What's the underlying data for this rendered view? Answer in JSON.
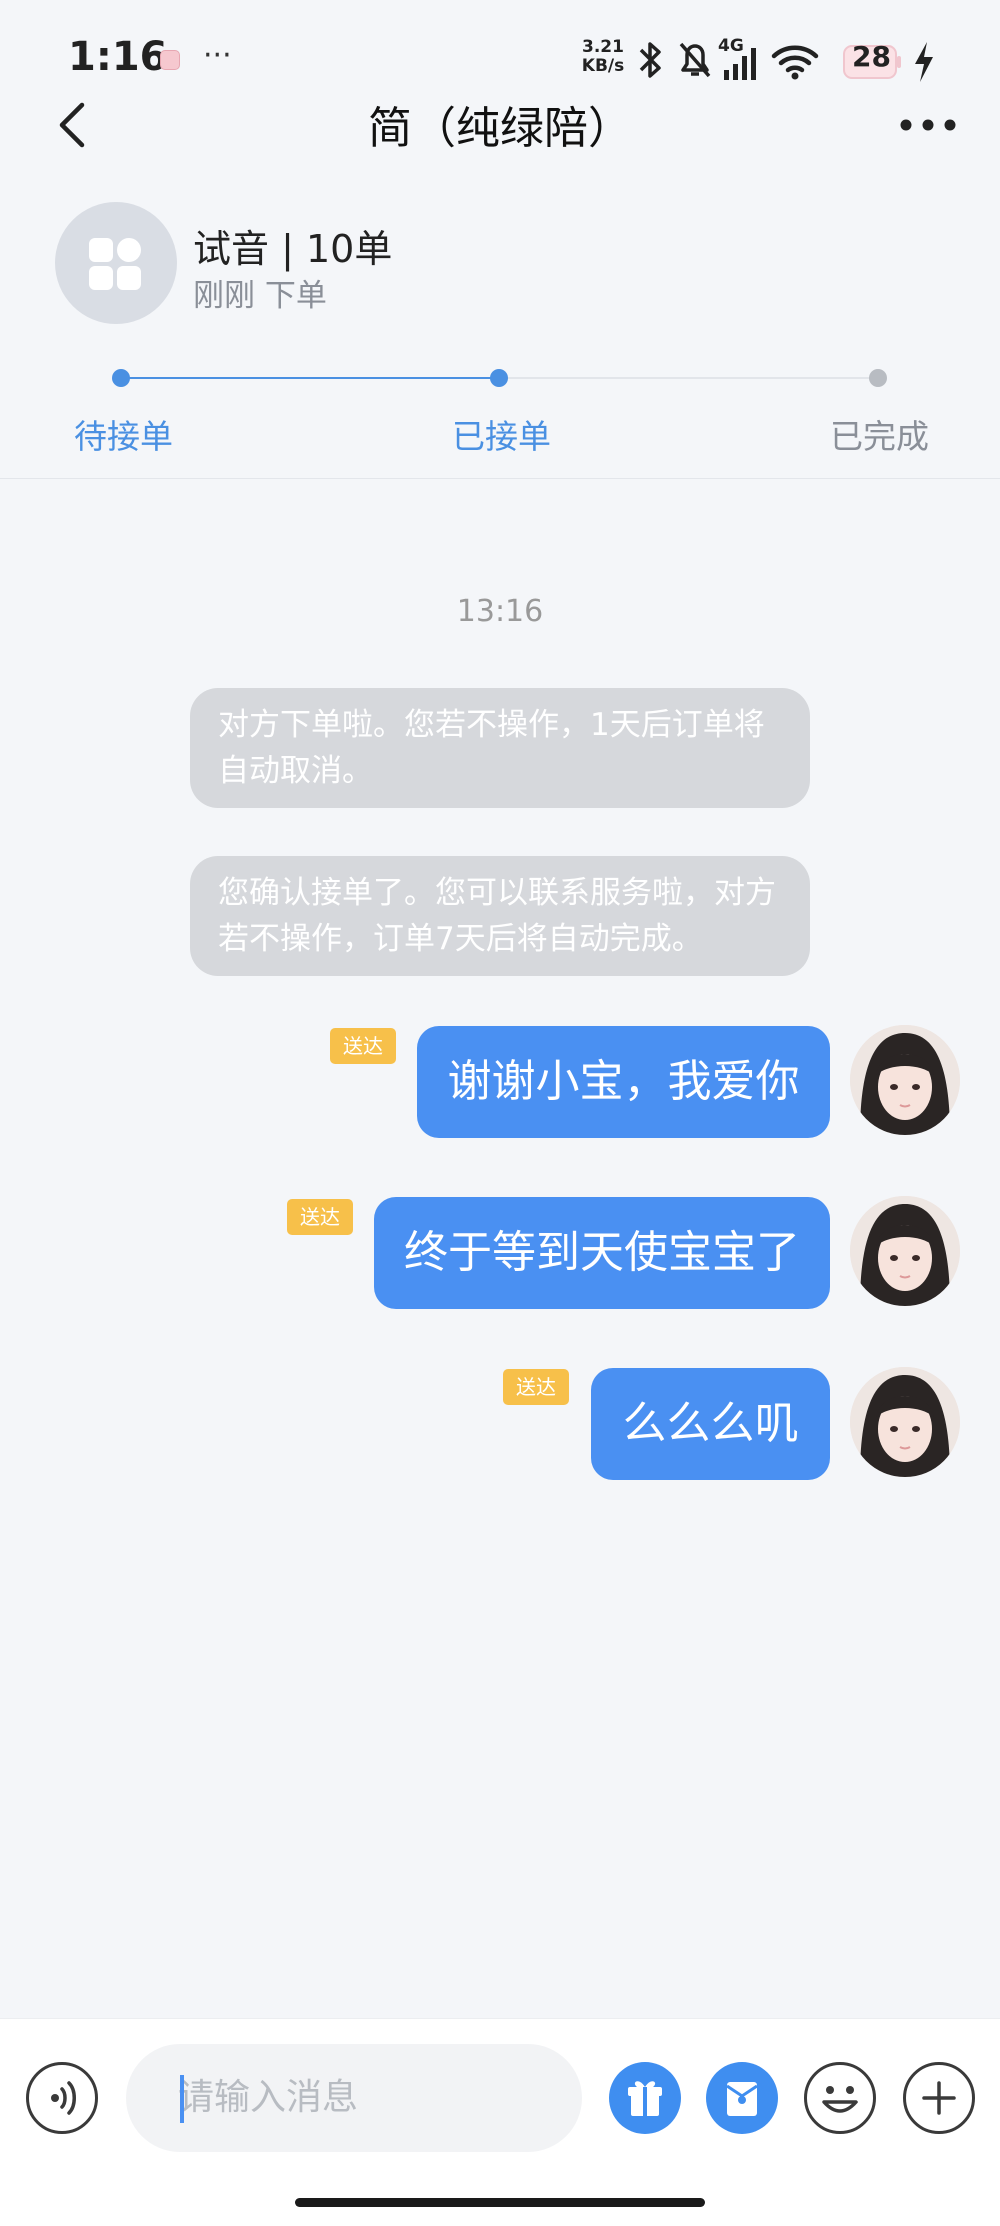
{
  "status_bar": {
    "time": "1:16",
    "more": "···",
    "net_speed_value": "3.21",
    "net_speed_unit": "KB/s",
    "network_type": "4G",
    "battery_level": "28",
    "icons": [
      "bluetooth-icon",
      "mute-icon",
      "signal-icon",
      "wifi-icon",
      "battery-icon",
      "charging-icon"
    ]
  },
  "header": {
    "title": "简（纯绿陪）"
  },
  "order": {
    "title": "试音 | 10单",
    "subtitle": "刚刚 下单"
  },
  "progress": {
    "steps": [
      {
        "label": "待接单",
        "state": "done"
      },
      {
        "label": "已接单",
        "state": "current"
      },
      {
        "label": "已完成",
        "state": "pending"
      }
    ],
    "active_color": "#4a90e2",
    "inactive_color": "#b8bcc2"
  },
  "chat": {
    "time": "13:16",
    "system_messages": [
      "对方下单啦。您若不操作，1天后订单将自动取消。",
      "您确认接单了。您可以联系服务啦，对方若不操作，订单7天后将自动完成。"
    ],
    "messages": [
      {
        "text": "谢谢小宝，我爱你",
        "status": "送达"
      },
      {
        "text": "终于等到天使宝宝了",
        "status": "送达"
      },
      {
        "text": "么么么叽",
        "status": "送达"
      }
    ]
  },
  "input": {
    "placeholder": "请输入消息"
  },
  "colors": {
    "accent": "#4a90f2",
    "badge": "#f7c04a",
    "system_bubble": "#d6d8dc"
  }
}
